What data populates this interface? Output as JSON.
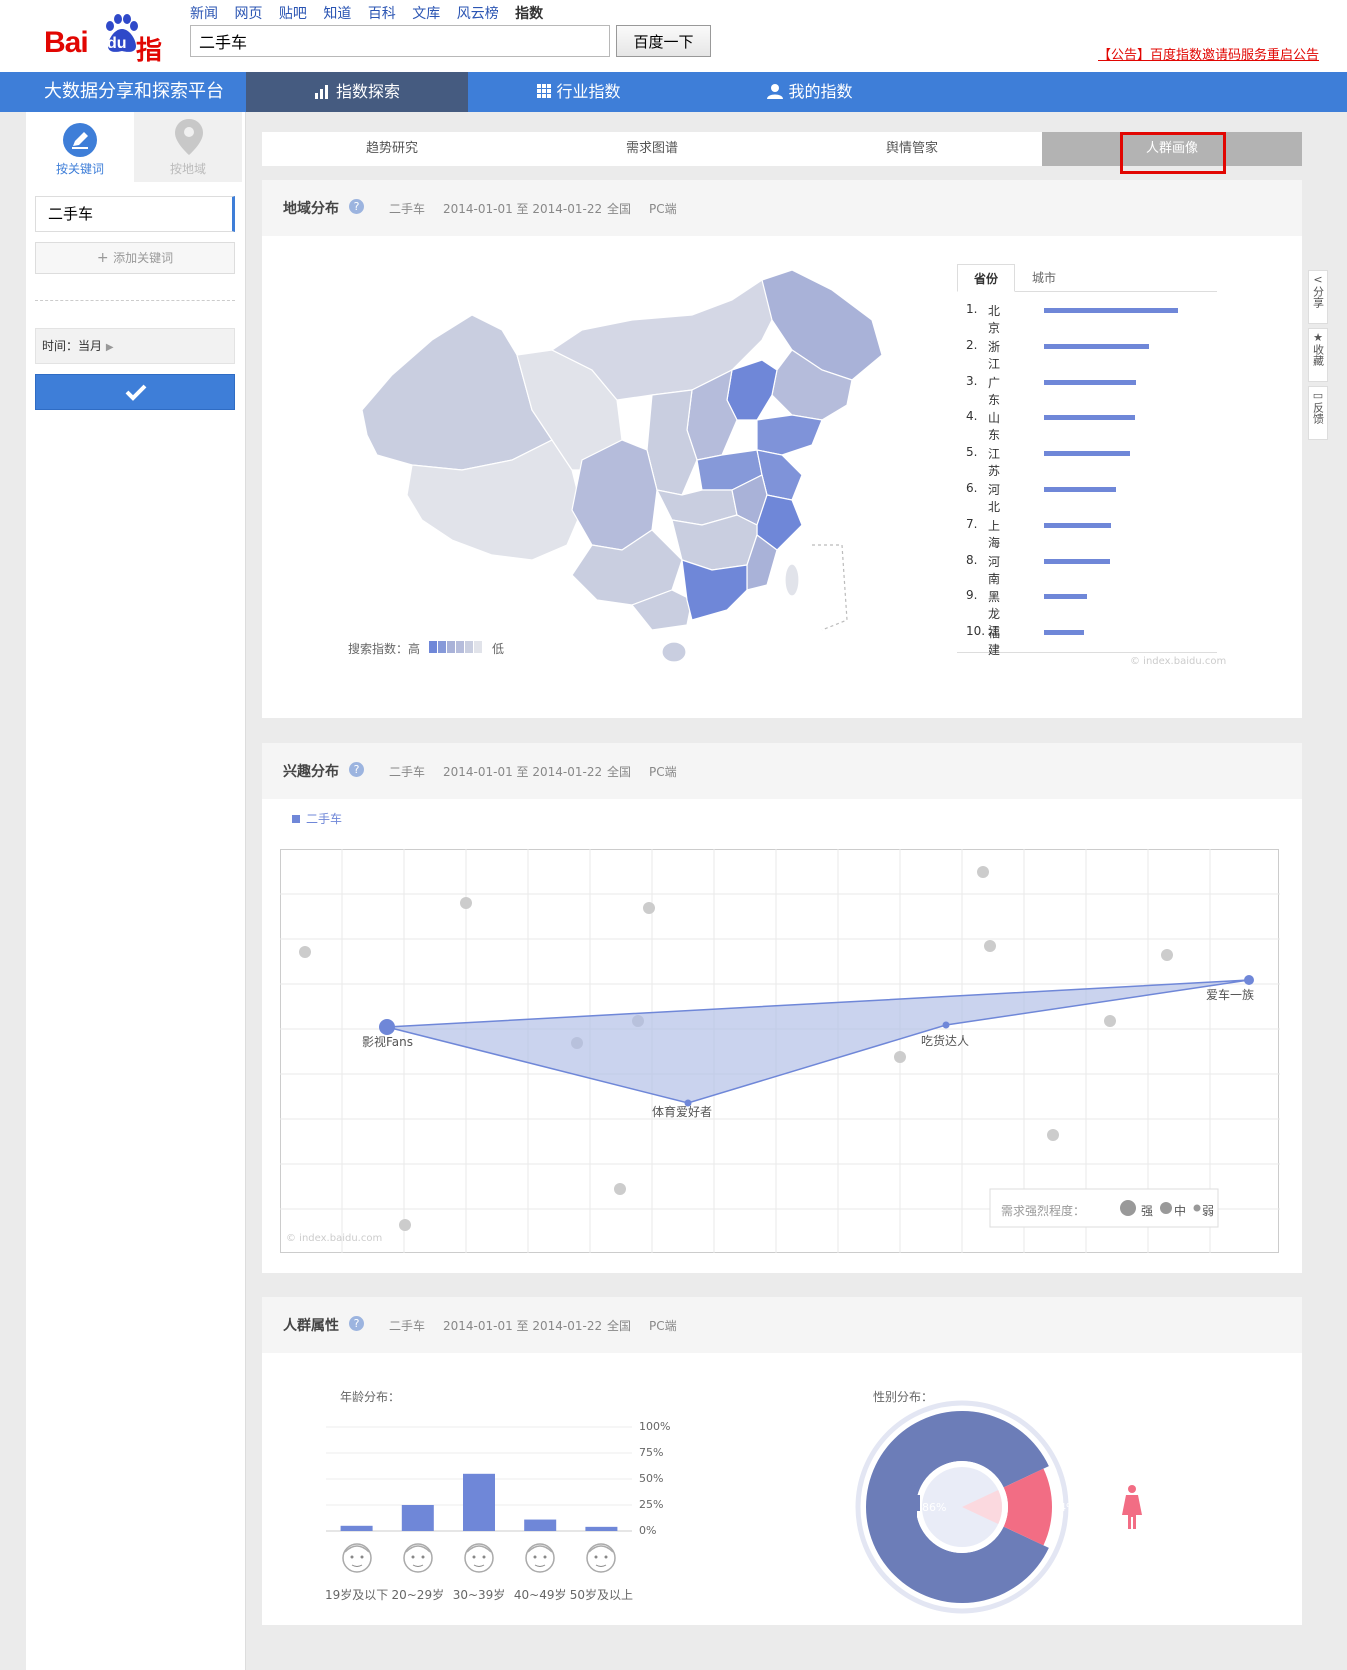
{
  "header": {
    "logo_text_bai": "Bai",
    "logo_text_du": "du",
    "logo_text_zhishu": "指数",
    "top_nav": [
      "新闻",
      "网页",
      "贴吧",
      "知道",
      "百科",
      "文库",
      "风云榜",
      "指数"
    ],
    "search_value": "二手车",
    "search_button": "百度一下",
    "announcement": "【公告】百度指数邀请码服务重启公告"
  },
  "main_nav": {
    "brand": "大数据分享和探索平台",
    "items": [
      "指数探索",
      "行业指数",
      "我的指数"
    ]
  },
  "sidebar": {
    "tab_keyword": "按关键词",
    "tab_region": "按地域",
    "keyword": "二手车",
    "add_keyword": "添加关键词",
    "time_label": "时间：当月"
  },
  "sub_tabs": [
    "趋势研究",
    "需求图谱",
    "舆情管家",
    "人群画像"
  ],
  "meta": {
    "keyword": "二手车",
    "date_range": "2014-01-01 至 2014-01-22",
    "area": "全国",
    "device": "PC端"
  },
  "region_panel": {
    "title": "地域分布",
    "tabs": [
      "省份",
      "城市"
    ],
    "legend_label": "搜索指数：高",
    "legend_low": "低",
    "watermark": "© index.baidu.com",
    "ranking": [
      {
        "rank": "1.",
        "name": "北京",
        "value": 100
      },
      {
        "rank": "2.",
        "name": "浙江",
        "value": 78
      },
      {
        "rank": "3.",
        "name": "广东",
        "value": 69
      },
      {
        "rank": "4.",
        "name": "山东",
        "value": 68
      },
      {
        "rank": "5.",
        "name": "江苏",
        "value": 64
      },
      {
        "rank": "6.",
        "name": "河北",
        "value": 54
      },
      {
        "rank": "7.",
        "name": "上海",
        "value": 50
      },
      {
        "rank": "8.",
        "name": "河南",
        "value": 49
      },
      {
        "rank": "9.",
        "name": "黑龙江",
        "value": 32
      },
      {
        "rank": "10.",
        "name": "福建",
        "value": 30
      }
    ],
    "colors": {
      "high": "#6f87d8",
      "mid": "#a9b5dc",
      "low": "#e6e8ef"
    }
  },
  "interest_panel": {
    "title": "兴趣分布",
    "series_name": "二手车",
    "watermark": "© index.baidu.com",
    "legend_title": "需求强烈程度：",
    "legend_items": [
      "强",
      "中",
      "弱"
    ],
    "labels": [
      "影视Fans",
      "体育爱好者",
      "吃货达人",
      "爱车一族"
    ]
  },
  "crowd_panel": {
    "title": "人群属性",
    "age_title": "年龄分布：",
    "gender_title": "性别分布：",
    "age_axis": [
      "100%",
      "75%",
      "50%",
      "25%",
      "0%"
    ],
    "age_groups": [
      "19岁及以下",
      "20~29岁",
      "30~39岁",
      "40~49岁",
      "50岁及以上"
    ],
    "male_pct": "86%",
    "female_pct": "14%",
    "male_color": "#6c7db8",
    "female_color": "#f26d84"
  },
  "chart_data": [
    {
      "type": "bar",
      "title": "",
      "categories": [
        "19岁及以下",
        "20~29岁",
        "30~39岁",
        "40~49岁",
        "50岁及以上"
      ],
      "values": [
        5,
        25,
        55,
        11,
        4
      ],
      "ylim": [
        0,
        100
      ],
      "ylabel": "",
      "xlabel": ""
    },
    {
      "type": "pie",
      "categories": [
        "男",
        "女"
      ],
      "values": [
        86,
        14
      ]
    },
    {
      "type": "bar",
      "categories": [
        "北京",
        "浙江",
        "广东",
        "山东",
        "江苏",
        "河北",
        "上海",
        "河南",
        "黑龙江",
        "福建"
      ],
      "values": [
        100,
        78,
        69,
        68,
        64,
        54,
        50,
        49,
        32,
        30
      ]
    }
  ],
  "float_right": [
    "分享",
    "收藏",
    "反馈"
  ]
}
